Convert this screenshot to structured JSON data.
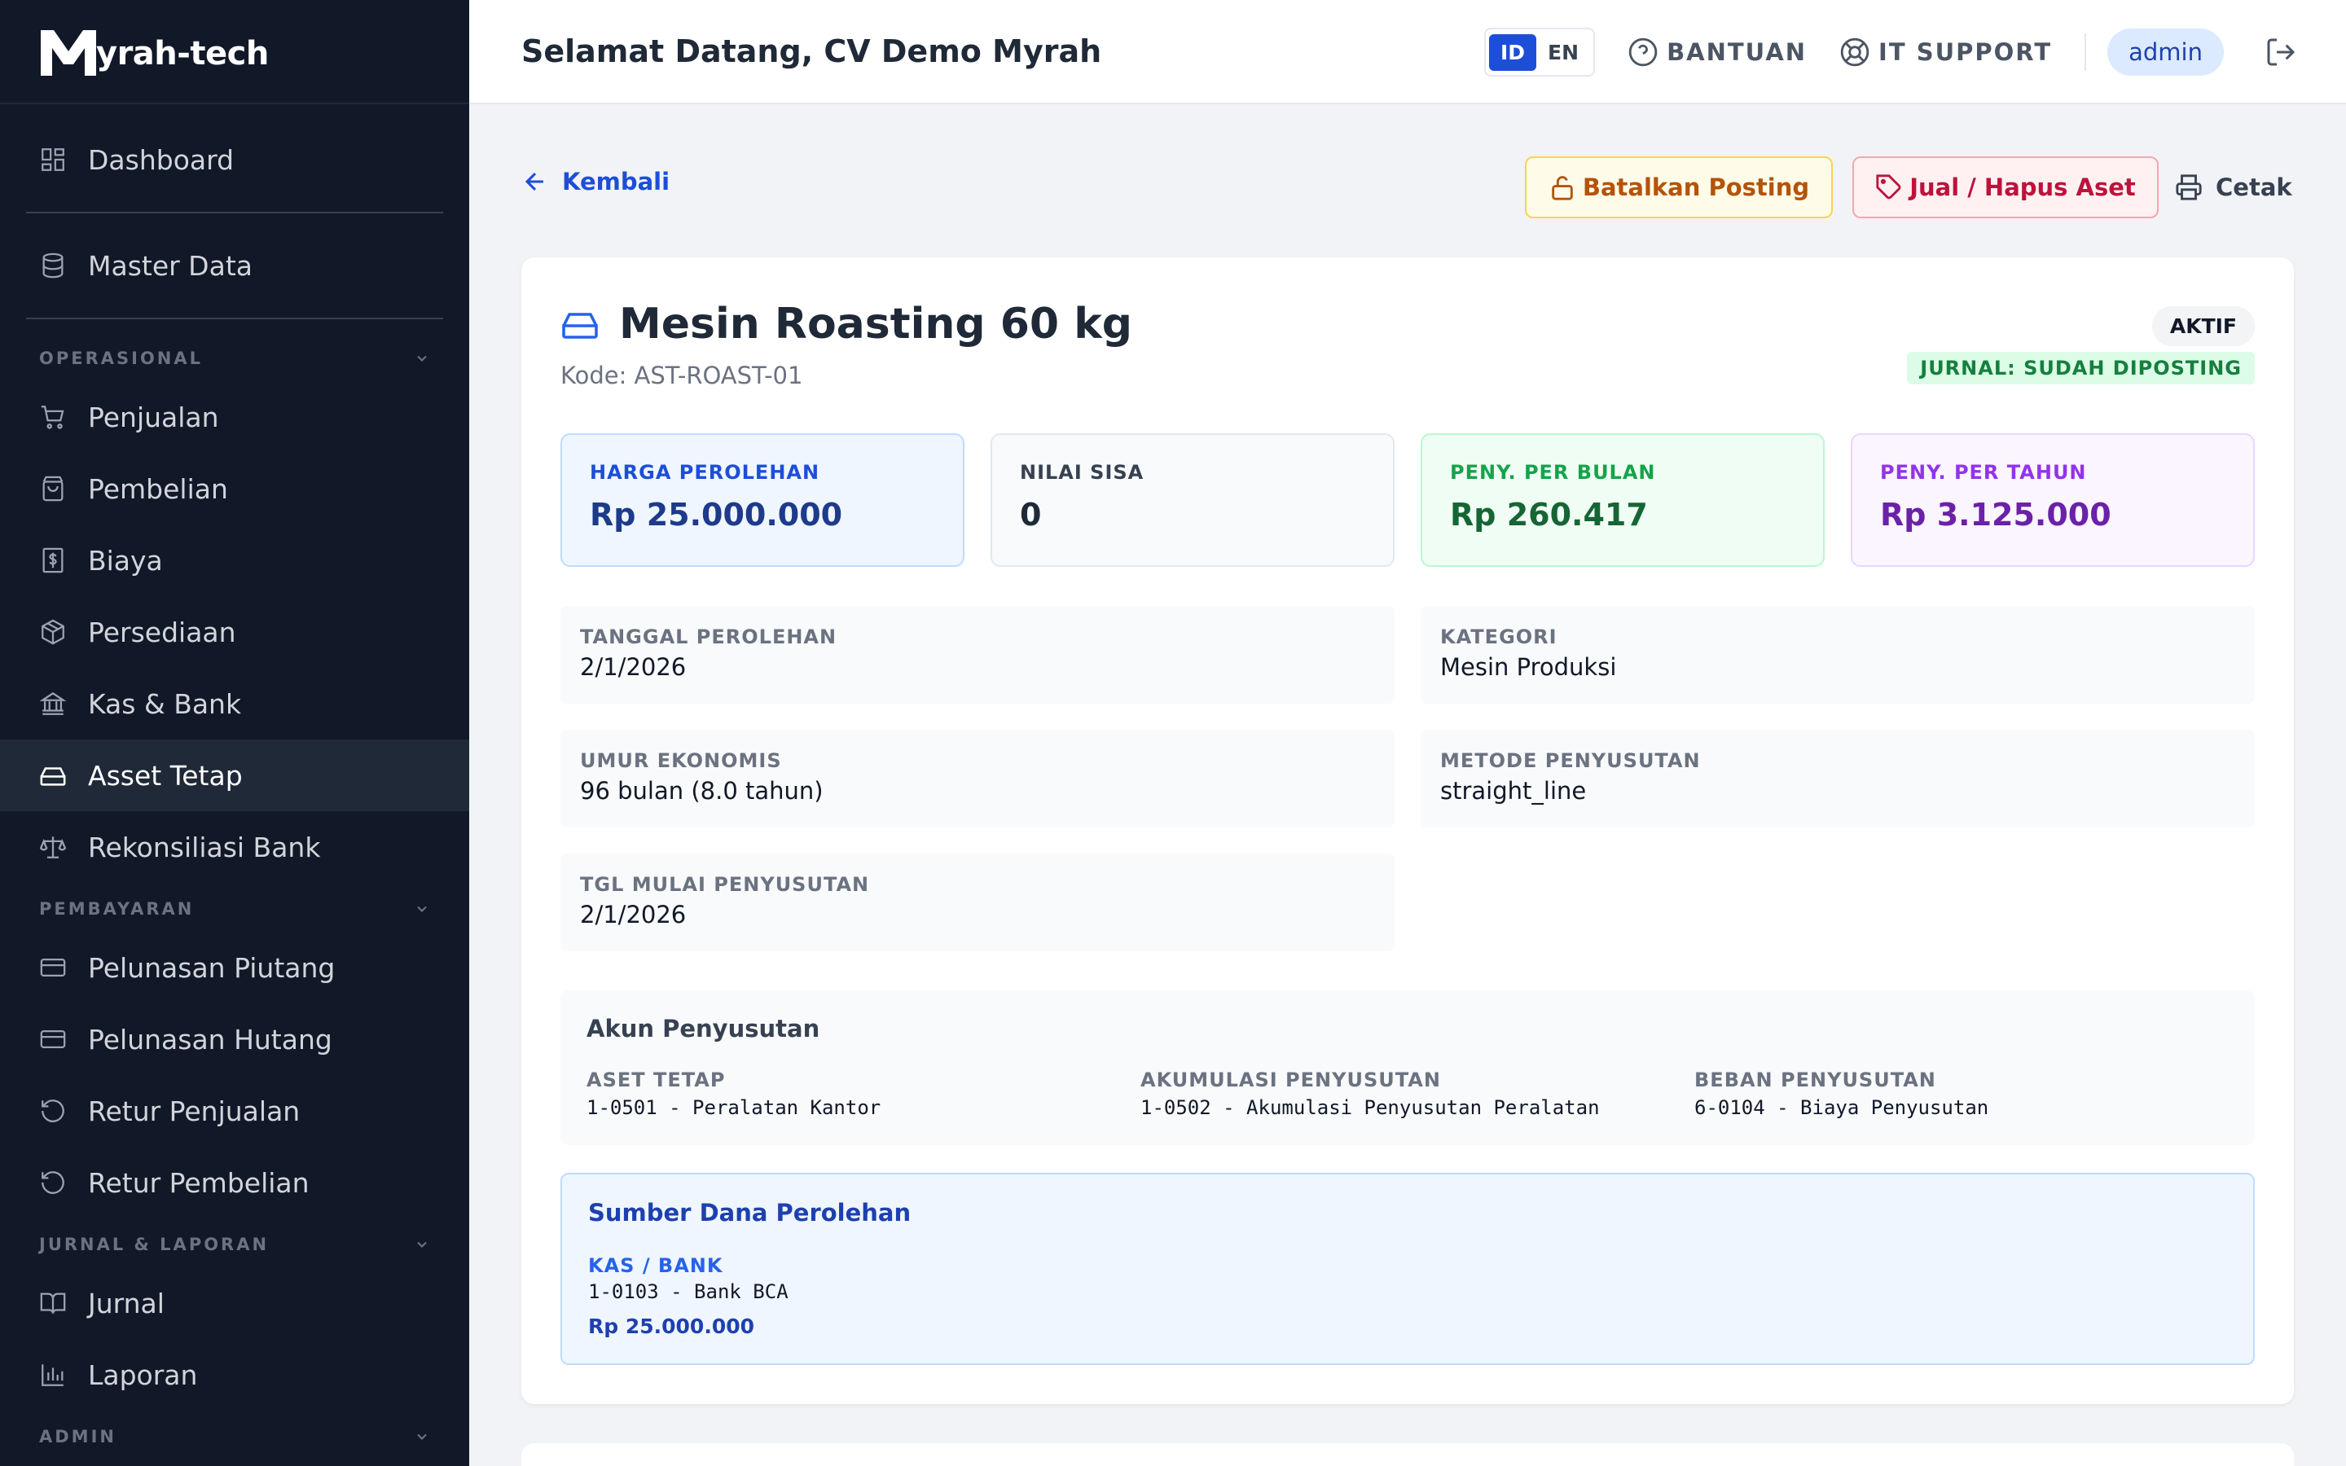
{
  "brand": {
    "name": "yrah-tech"
  },
  "sidebar": {
    "top_items": [
      {
        "label": "Dashboard",
        "icon": "grid-icon"
      },
      {
        "label": "Master Data",
        "icon": "database-icon"
      }
    ],
    "sections": [
      {
        "title": "OPERASIONAL",
        "items": [
          {
            "label": "Penjualan",
            "icon": "cart-icon"
          },
          {
            "label": "Pembelian",
            "icon": "bag-icon"
          },
          {
            "label": "Biaya",
            "icon": "dollar-receipt-icon"
          },
          {
            "label": "Persediaan",
            "icon": "box-icon"
          },
          {
            "label": "Kas & Bank",
            "icon": "bank-icon"
          },
          {
            "label": "Asset Tetap",
            "icon": "hard-drive-icon",
            "active": true
          },
          {
            "label": "Rekonsiliasi Bank",
            "icon": "scale-icon"
          }
        ]
      },
      {
        "title": "PEMBAYARAN",
        "items": [
          {
            "label": "Pelunasan Piutang",
            "icon": "credit-card-icon"
          },
          {
            "label": "Pelunasan Hutang",
            "icon": "credit-card-icon"
          },
          {
            "label": "Retur Penjualan",
            "icon": "rotate-icon"
          },
          {
            "label": "Retur Pembelian",
            "icon": "rotate-icon"
          }
        ]
      },
      {
        "title": "JURNAL & LAPORAN",
        "items": [
          {
            "label": "Jurnal",
            "icon": "book-icon"
          },
          {
            "label": "Laporan",
            "icon": "bar-chart-icon"
          }
        ]
      },
      {
        "title": "ADMIN",
        "items": []
      }
    ]
  },
  "header": {
    "welcome": "Selamat Datang, CV Demo Myrah",
    "lang_id": "ID",
    "lang_en": "EN",
    "help": "BANTUAN",
    "support": "IT SUPPORT",
    "user": "admin"
  },
  "actions": {
    "back": "Kembali",
    "unpost": "Batalkan Posting",
    "sell": "Jual / Hapus Aset",
    "print": "Cetak"
  },
  "asset": {
    "title": "Mesin Roasting 60 kg",
    "code": "Kode: AST-ROAST-01",
    "status": "AKTIF",
    "journal_status": "JURNAL: SUDAH DIPOSTING"
  },
  "stats": [
    {
      "label": "HARGA PEROLEHAN",
      "value": "Rp 25.000.000"
    },
    {
      "label": "NILAI SISA",
      "value": "0"
    },
    {
      "label": "PENY. PER BULAN",
      "value": "Rp 260.417"
    },
    {
      "label": "PENY. PER TAHUN",
      "value": "Rp 3.125.000"
    }
  ],
  "details": {
    "acq_date": {
      "label": "TANGGAL PEROLEHAN",
      "value": "2/1/2026"
    },
    "category": {
      "label": "KATEGORI",
      "value": "Mesin Produksi"
    },
    "life": {
      "label": "UMUR EKONOMIS",
      "value": "96 bulan (8.0 tahun)"
    },
    "method": {
      "label": "METODE PENYUSUTAN",
      "value": "straight_line"
    },
    "dep_start": {
      "label": "TGL MULAI PENYUSUTAN",
      "value": "2/1/2026"
    }
  },
  "accounts": {
    "title": "Akun Penyusutan",
    "asset": {
      "label": "ASET TETAP",
      "value": "1-0501 - Peralatan Kantor"
    },
    "accum": {
      "label": "AKUMULASI PENYUSUTAN",
      "value": "1-0502 - Akumulasi Penyusutan Peralatan"
    },
    "expense": {
      "label": "BEBAN PENYUSUTAN",
      "value": "6-0104 - Biaya Penyusutan"
    }
  },
  "funding": {
    "title": "Sumber Dana Perolehan",
    "label": "KAS / BANK",
    "account": "1-0103 - Bank BCA",
    "amount": "Rp 25.000.000"
  }
}
